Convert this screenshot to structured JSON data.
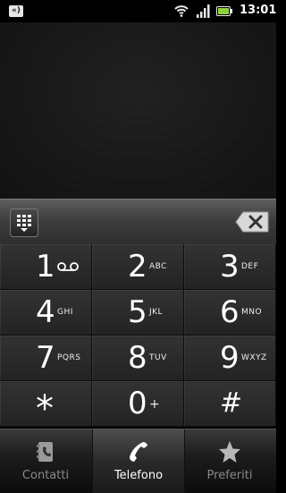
{
  "status_bar": {
    "time": "13:01",
    "notification": "«)"
  },
  "keys": [
    {
      "digit": "1",
      "letters": ""
    },
    {
      "digit": "2",
      "letters": "ABC"
    },
    {
      "digit": "3",
      "letters": "DEF"
    },
    {
      "digit": "4",
      "letters": "GHI"
    },
    {
      "digit": "5",
      "letters": "JKL"
    },
    {
      "digit": "6",
      "letters": "MNO"
    },
    {
      "digit": "7",
      "letters": "PQRS"
    },
    {
      "digit": "8",
      "letters": "TUV"
    },
    {
      "digit": "9",
      "letters": "WXYZ"
    },
    {
      "digit": "*",
      "letters": ""
    },
    {
      "digit": "0",
      "letters": "+"
    },
    {
      "digit": "#",
      "letters": ""
    }
  ],
  "tabs": [
    {
      "label": "Contatti",
      "icon": "contacts-icon"
    },
    {
      "label": "Telefono",
      "icon": "phone-handset-icon"
    },
    {
      "label": "Preferiti",
      "icon": "star-icon"
    }
  ],
  "colors": {
    "active_tab_label": "#ffffff",
    "inactive_tab_label": "#8a8a8a",
    "background": "#000000"
  }
}
